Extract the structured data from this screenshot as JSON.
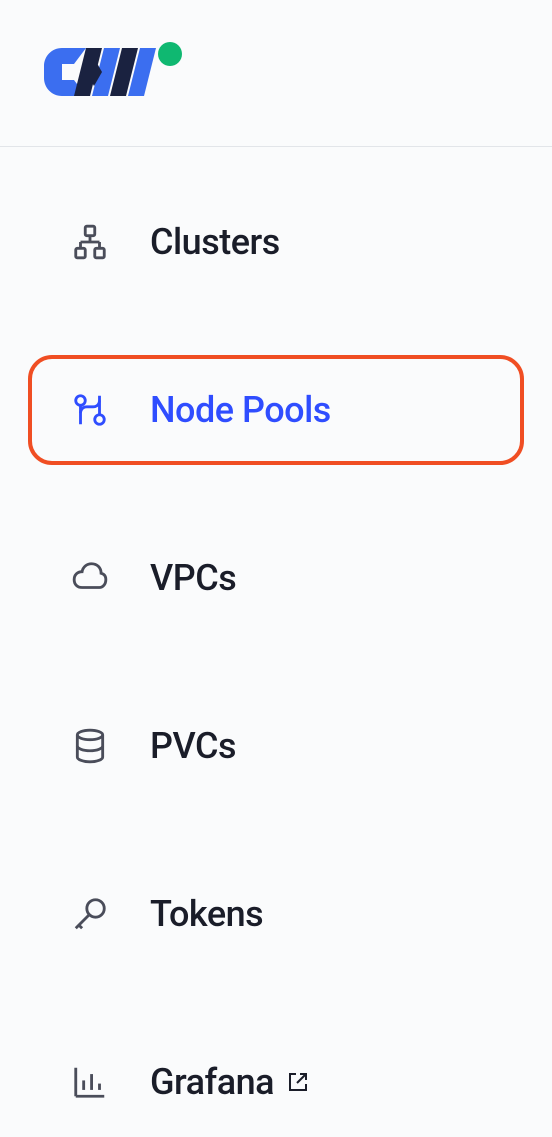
{
  "nav": {
    "items": [
      {
        "label": "Clusters",
        "icon": "clusters-icon",
        "active": false,
        "external": false
      },
      {
        "label": "Node Pools",
        "icon": "node-pools-icon",
        "active": true,
        "external": false
      },
      {
        "label": "VPCs",
        "icon": "cloud-icon",
        "active": false,
        "external": false
      },
      {
        "label": "PVCs",
        "icon": "database-icon",
        "active": false,
        "external": false
      },
      {
        "label": "Tokens",
        "icon": "key-icon",
        "active": false,
        "external": false
      },
      {
        "label": "Grafana",
        "icon": "chart-icon",
        "active": false,
        "external": true
      }
    ]
  },
  "colors": {
    "accent": "#2f4dff",
    "highlight_border": "#f04e23",
    "text": "#1a1d29",
    "icon": "#4a4d5a",
    "logo_blue": "#3b6ef0",
    "logo_dark": "#1a2240",
    "logo_green": "#0fb871"
  }
}
